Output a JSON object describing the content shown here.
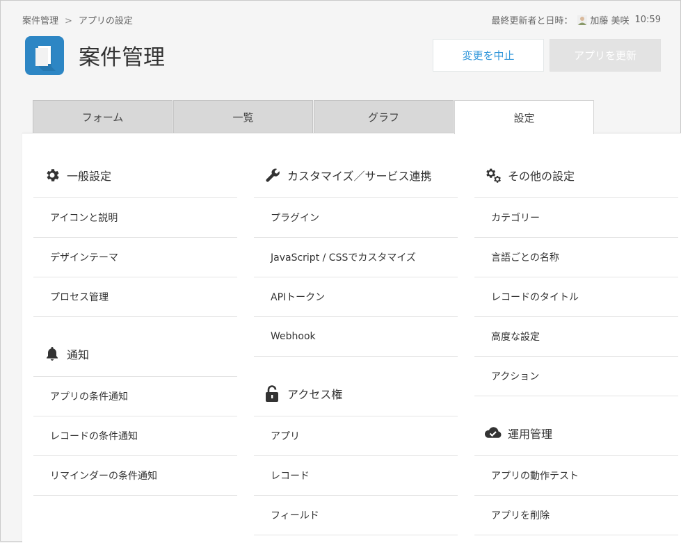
{
  "breadcrumb": {
    "root": "案件管理",
    "separator": ">",
    "current": "アプリの設定"
  },
  "last_updated": {
    "label": "最終更新者と日時：",
    "user": "加藤 美咲",
    "time": "10:59"
  },
  "app": {
    "title": "案件管理"
  },
  "buttons": {
    "cancel": "変更を中止",
    "update": "アプリを更新"
  },
  "tabs": [
    {
      "label": "フォーム",
      "active": false
    },
    {
      "label": "一覧",
      "active": false
    },
    {
      "label": "グラフ",
      "active": false
    },
    {
      "label": "設定",
      "active": true
    }
  ],
  "sections": {
    "general": {
      "title": "一般設定",
      "icon": "gear-icon",
      "items": [
        "アイコンと説明",
        "デザインテーマ",
        "プロセス管理"
      ]
    },
    "notification": {
      "title": "通知",
      "icon": "bell-icon",
      "items": [
        "アプリの条件通知",
        "レコードの条件通知",
        "リマインダーの条件通知"
      ]
    },
    "customize": {
      "title": "カスタマイズ／サービス連携",
      "icon": "wrench-icon",
      "items": [
        "プラグイン",
        "JavaScript / CSSでカスタマイズ",
        "APIトークン",
        "Webhook"
      ]
    },
    "access": {
      "title": "アクセス権",
      "icon": "lock-icon",
      "items": [
        "アプリ",
        "レコード",
        "フィールド"
      ]
    },
    "other": {
      "title": "その他の設定",
      "icon": "gears-icon",
      "items": [
        "カテゴリー",
        "言語ごとの名称",
        "レコードのタイトル",
        "高度な設定",
        "アクション"
      ]
    },
    "operation": {
      "title": "運用管理",
      "icon": "cloud-check-icon",
      "items": [
        "アプリの動作テスト",
        "アプリを削除"
      ]
    }
  },
  "colors": {
    "accent": "#3498db",
    "app_icon_bg": "#2d86c4",
    "tab_inactive": "#d8d8d8"
  }
}
